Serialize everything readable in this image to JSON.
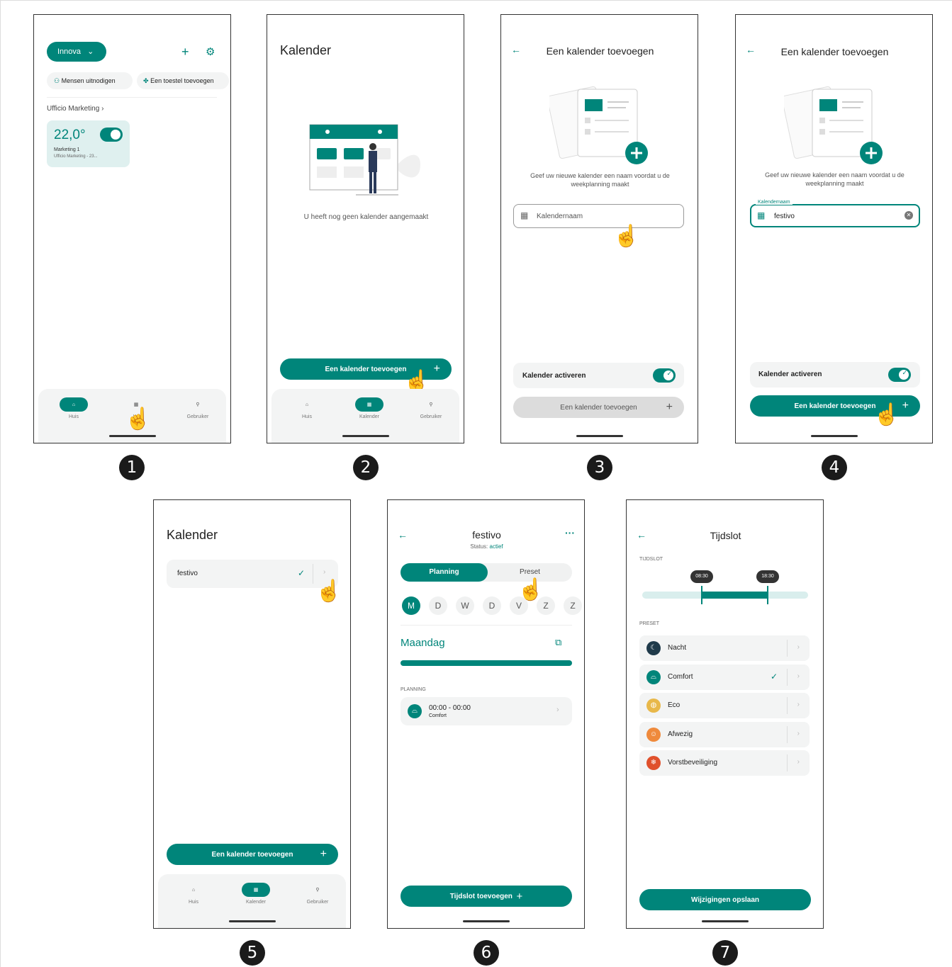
{
  "s1": {
    "house": "Innova",
    "invite": "Mensen uitnodigen",
    "add_device": "Een toestel toevoegen",
    "room": "Ufficio Marketing ›",
    "temp": "22,0°",
    "zone": "Marketing 1",
    "zone_sub": "Ufficio Marketing - 23..."
  },
  "nav": {
    "home": "Huis",
    "calendar": "Kalender",
    "user": "Gebruiker",
    "calendar_partial": "Ka"
  },
  "s2": {
    "title": "Kalender",
    "empty": "U heeft nog geen kalender aangemaakt",
    "add": "Een kalender toevoegen"
  },
  "s3": {
    "title": "Een kalender toevoegen",
    "hint": "Geef uw nieuwe kalender een naam voordat u de weekplanning maakt",
    "placeholder": "Kalendernaam",
    "activate": "Kalender activeren",
    "add": "Een kalender toevoegen"
  },
  "s4": {
    "title": "Een kalender toevoegen",
    "hint": "Geef uw nieuwe kalender een naam voordat u de weekplanning maakt",
    "field_label": "Kalendernaam",
    "value": "festivo",
    "activate": "Kalender activeren",
    "add": "Een kalender toevoegen"
  },
  "s5": {
    "title": "Kalender",
    "item": "festivo",
    "add": "Een kalender toevoegen"
  },
  "s6": {
    "title": "festivo",
    "status_label": "Status:",
    "status_value": "actief",
    "tab1": "Planning",
    "tab2": "Preset",
    "days": [
      "M",
      "D",
      "W",
      "D",
      "V",
      "Z",
      "Z"
    ],
    "day_title": "Maandag",
    "section": "PLANNING",
    "slot_time": "00:00 - 00:00",
    "slot_preset": "Comfort",
    "add": "Tijdslot toevoegen"
  },
  "s7": {
    "title": "Tijdslot",
    "slot_label": "TIJDSLOT",
    "start": "08:30",
    "end": "18:30",
    "preset_label": "PRESET",
    "presets": [
      "Nacht",
      "Comfort",
      "Eco",
      "Afwezig",
      "Vorstbeveiliging"
    ],
    "preset_colors": [
      "#1f3a4a",
      "#00857a",
      "#e8b84a",
      "#ef8a3c",
      "#e0502b"
    ],
    "save": "Wijzigingen opslaan"
  },
  "steps": [
    "1",
    "2",
    "3",
    "4",
    "5",
    "6",
    "7"
  ]
}
